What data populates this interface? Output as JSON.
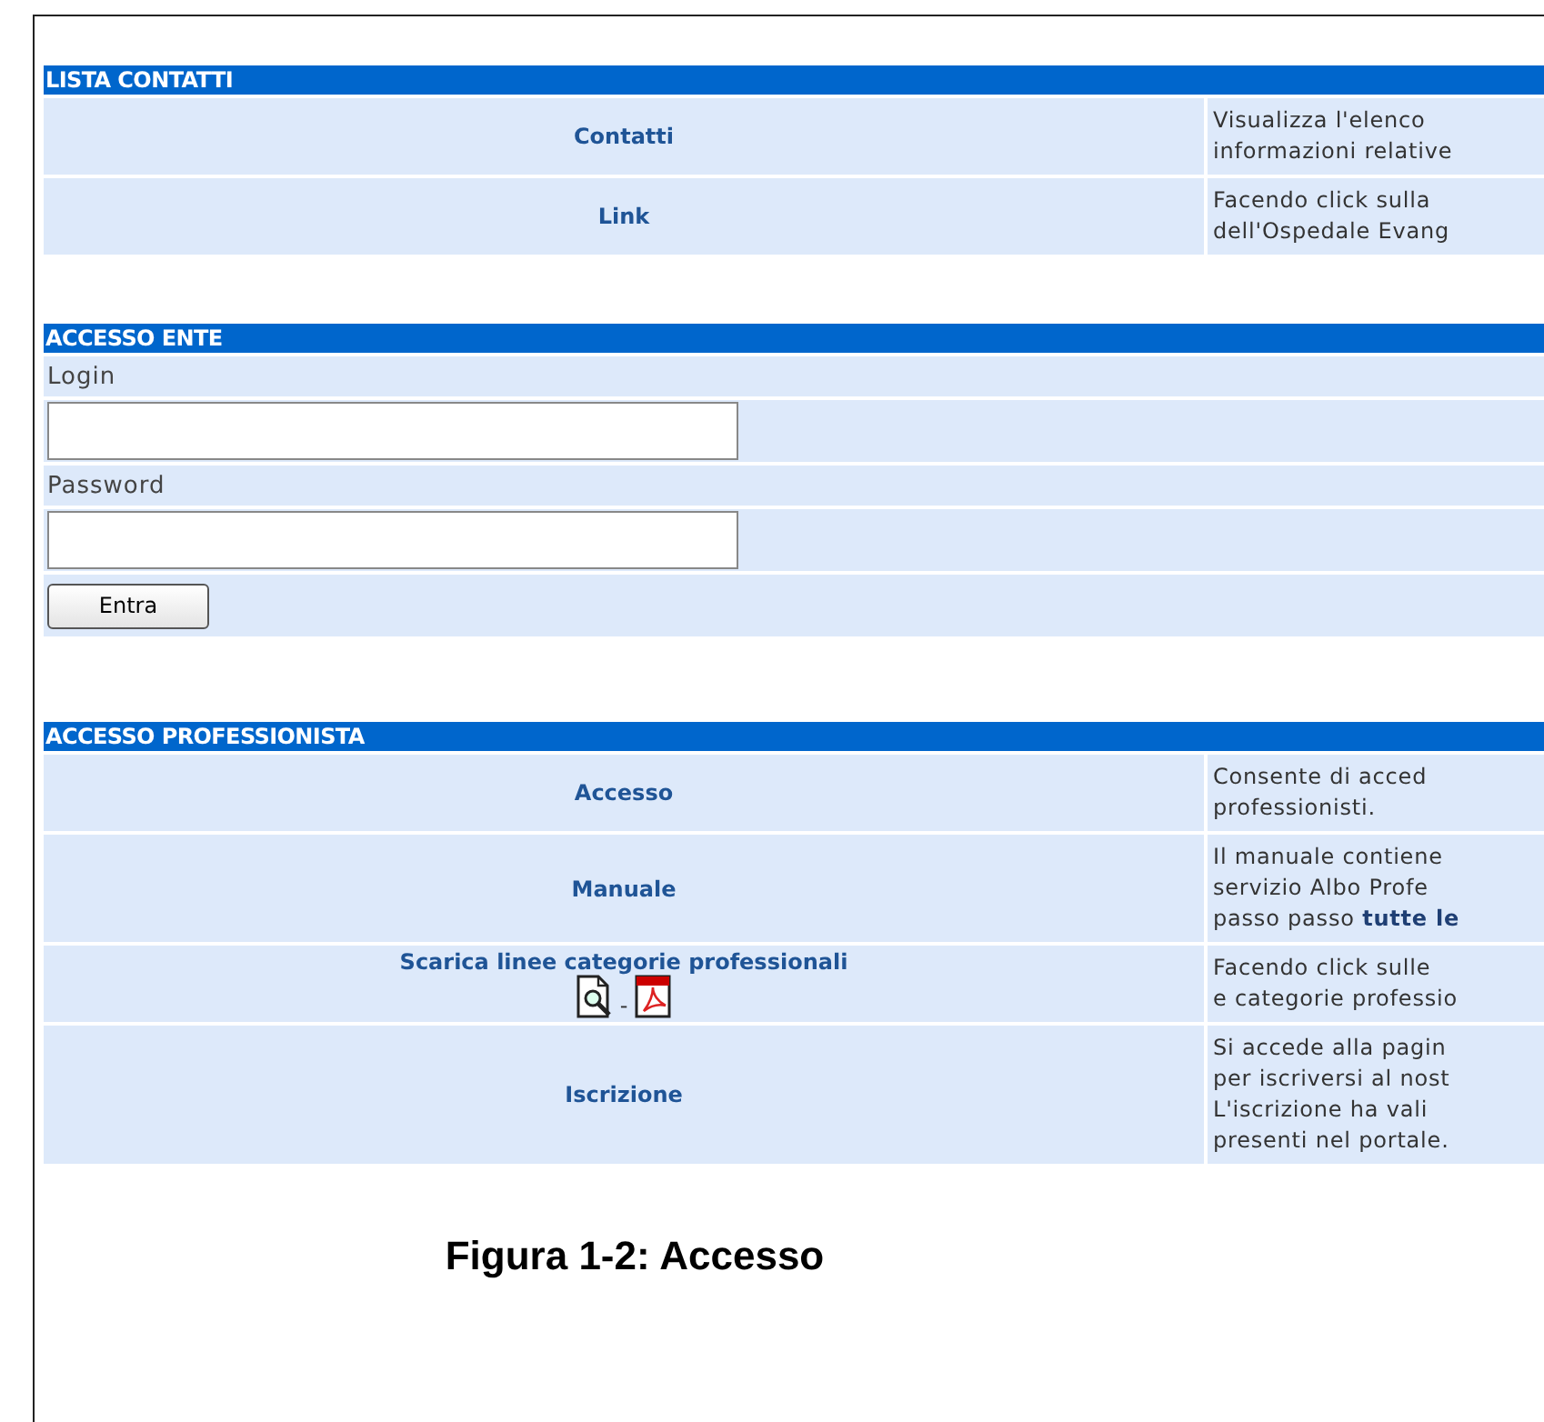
{
  "sections": [
    {
      "kind": "links",
      "title": "LISTA CONTATTI",
      "rows": [
        {
          "label": "Contatti",
          "description": [
            "Visualizza l'elenco",
            "informazioni relative"
          ]
        },
        {
          "label": "Link",
          "description": [
            "Facendo click sulla",
            "dell'Ospedale Evang"
          ]
        }
      ]
    },
    {
      "kind": "login",
      "title": "ACCESSO ENTE",
      "fields": [
        {
          "label": "Login"
        },
        {
          "label": "Password"
        }
      ],
      "button": "Entra"
    },
    {
      "kind": "links",
      "title": "ACCESSO PROFESSIONISTA",
      "rows": [
        {
          "label": "Accesso",
          "description": [
            "Consente di acced",
            "professionisti."
          ]
        },
        {
          "label": "Manuale",
          "description": [
            "Il manuale contiene",
            "servizio Albo Profe",
            "passo passo **tutte le**"
          ]
        },
        {
          "label": "Scarica linee categorie professionali",
          "icons_separator": "-",
          "description": [
            "Facendo click sulle",
            "e categorie professio"
          ]
        },
        {
          "label": "Iscrizione",
          "description": [
            "Si accede alla pagin",
            "per iscriversi al nost",
            "L'iscrizione ha vali",
            "presenti nel portale."
          ]
        }
      ]
    }
  ],
  "caption": "Figura 1-2: Accesso"
}
